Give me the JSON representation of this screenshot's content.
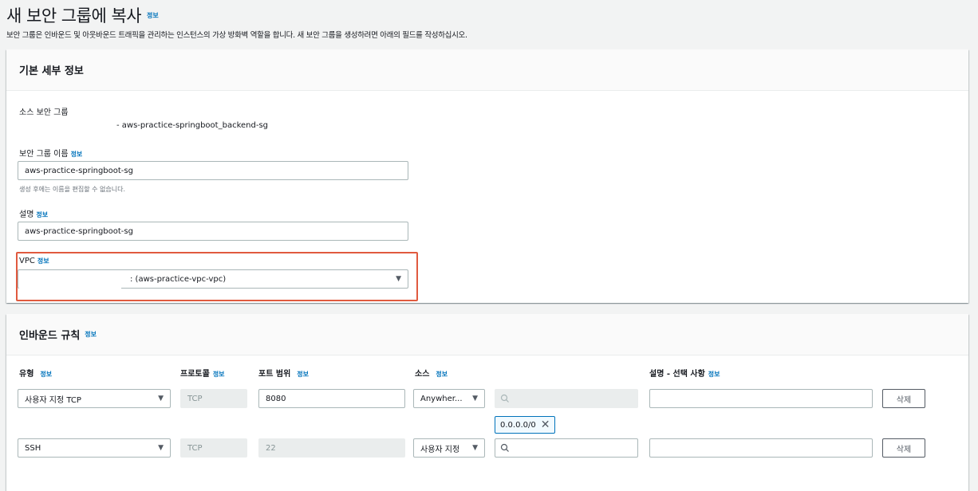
{
  "page": {
    "title": "새 보안 그룹에 복사",
    "info": "정보",
    "description": "보안 그룹은 인바운드 및 아웃바운드 트래픽을 관리하는 인스턴스의 가상 방화벽 역할을 합니다. 새 보안 그룹을 생성하려면 아래의 필드를 작성하십시오."
  },
  "basic": {
    "title": "기본 세부 정보",
    "source_label": "소스 보안 그룹",
    "source_value": "- aws-practice-springboot_backend-sg",
    "name_label": "보안 그룹 이름",
    "name_info": "정보",
    "name_value": "aws-practice-springboot-sg",
    "name_hint": "생성 후에는 이름을 편집할 수 없습니다.",
    "desc_label": "설명",
    "desc_info": "정보",
    "desc_value": "aws-practice-springboot-sg",
    "vpc_label": "VPC",
    "vpc_info": "정보",
    "vpc_value": ": (aws-practice-vpc-vpc)"
  },
  "inbound": {
    "title": "인바운드 규칙",
    "info": "정보",
    "columns": {
      "type": "유형",
      "protocol": "프로토콜",
      "port": "포트 범위",
      "source": "소스",
      "description": "설명 - 선택 사항",
      "info": "정보"
    },
    "rows": [
      {
        "type": "사용자 지정 TCP",
        "protocol": "TCP",
        "port": "8080",
        "source": "Anywher...",
        "token": "0.0.0.0/0",
        "delete": "삭제"
      },
      {
        "type": "SSH",
        "protocol": "TCP",
        "port": "22",
        "source": "사용자 지정",
        "delete": "삭제"
      }
    ]
  },
  "colors": {
    "link": "#0073bb",
    "highlight": "#e05a3f",
    "background": "#f2f3f3"
  }
}
